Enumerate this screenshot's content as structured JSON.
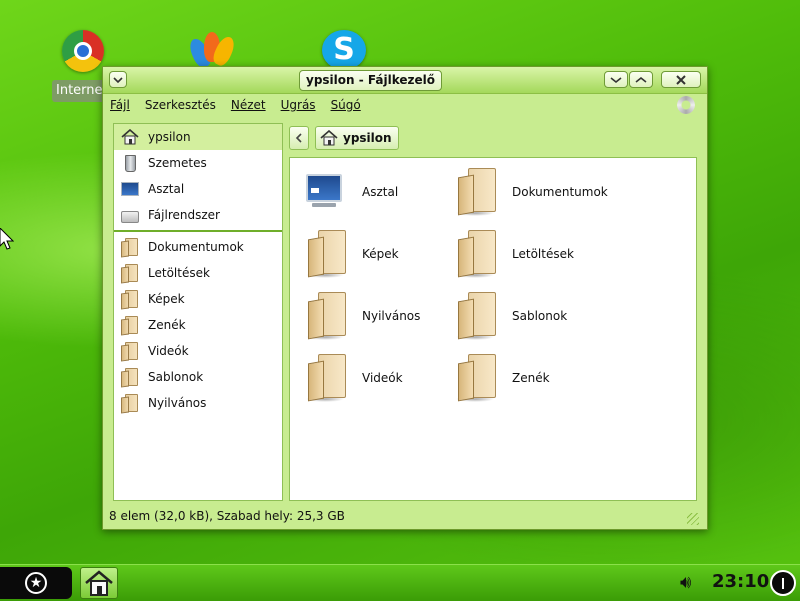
{
  "desktop": {
    "icons": [
      {
        "name": "chrome-icon",
        "label": "Internet"
      },
      {
        "name": "msn-icon",
        "label": ""
      },
      {
        "name": "skype-icon",
        "label": ""
      }
    ]
  },
  "window": {
    "title": "ypsilon - Fájlkezelő",
    "menu": [
      {
        "label": "Fájl",
        "key": "F"
      },
      {
        "label": "Szerkesztés",
        "key": "z"
      },
      {
        "label": "Nézet",
        "key": "N"
      },
      {
        "label": "Ugrás",
        "key": "U"
      },
      {
        "label": "Súgó",
        "key": "S"
      }
    ],
    "sidebar": {
      "places": [
        {
          "label": "ypsilon",
          "icon": "home-icon",
          "active": true
        },
        {
          "label": "Szemetes",
          "icon": "trash-icon"
        },
        {
          "label": "Asztal",
          "icon": "desktop-icon"
        },
        {
          "label": "Fájlrendszer",
          "icon": "drive-icon"
        }
      ],
      "bookmarks": [
        {
          "label": "Dokumentumok",
          "icon": "folder-icon"
        },
        {
          "label": "Letöltések",
          "icon": "folder-icon"
        },
        {
          "label": "Képek",
          "icon": "folder-icon"
        },
        {
          "label": "Zenék",
          "icon": "folder-icon"
        },
        {
          "label": "Videók",
          "icon": "folder-icon"
        },
        {
          "label": "Sablonok",
          "icon": "folder-icon"
        },
        {
          "label": "Nyilvános",
          "icon": "folder-icon"
        }
      ]
    },
    "location": {
      "back_icon": "chevron-left-icon",
      "crumb": "ypsilon"
    },
    "files": [
      {
        "label": "Asztal",
        "icon": "desktop-icon"
      },
      {
        "label": "Dokumentumok",
        "icon": "folder-icon"
      },
      {
        "label": "Képek",
        "icon": "folder-icon"
      },
      {
        "label": "Letöltések",
        "icon": "folder-icon"
      },
      {
        "label": "Nyilvános",
        "icon": "folder-icon"
      },
      {
        "label": "Sablonok",
        "icon": "folder-icon"
      },
      {
        "label": "Videók",
        "icon": "folder-icon"
      },
      {
        "label": "Zenék",
        "icon": "folder-icon"
      }
    ],
    "status": "8 elem (32,0 kB), Szabad hely: 25,3 GB"
  },
  "taskbar": {
    "clock": "23:10"
  },
  "colors": {
    "accent": "#c8ec90",
    "desktop": "#4fbc0a",
    "selection": "#d3ef9e"
  }
}
